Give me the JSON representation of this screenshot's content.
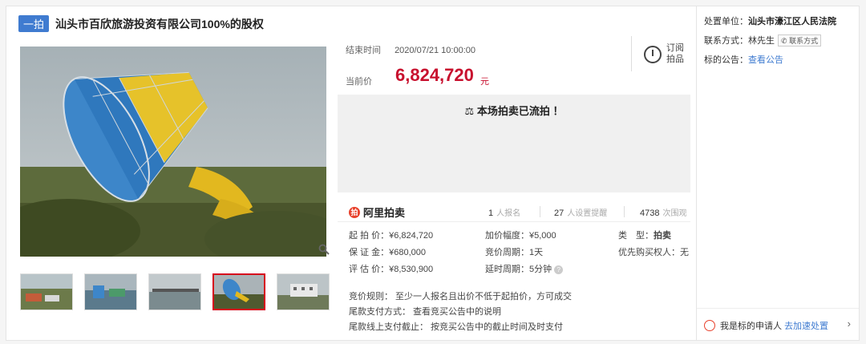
{
  "header": {
    "badge": "一拍",
    "title": "汕头市百欣旅游投资有限公司100%的股权"
  },
  "auction": {
    "end_label": "结束时间",
    "end_time": "2020/07/21 10:00:00",
    "price_label": "当前价",
    "price": "6,824,720",
    "price_unit": "元",
    "subscribe": "订阅拍品",
    "status": "本场拍卖已流拍 ！"
  },
  "platform": {
    "name": "阿里拍卖",
    "signups": "1",
    "signups_unit": "人报名",
    "reminders": "27",
    "reminders_unit": "人设置提醒",
    "watchers": "4738",
    "watchers_unit": "次围观"
  },
  "details": {
    "start_price": "起 拍 价：¥6,824,720",
    "increment": "加价幅度：¥5,000",
    "type_label": "类　型：",
    "type_value": "拍卖",
    "deposit": "保 证 金：¥680,000",
    "period": "竞价周期：1天",
    "priority": "优先购买权人：无",
    "appraisal": "评 估 价：¥8,530,900",
    "delay": "延时周期：5分钟"
  },
  "rules": {
    "rule": "竞价规则： 至少一人报名且出价不低于起拍价，方可成交",
    "payment": "尾款支付方式： 查看竞买公告中的说明",
    "deadline": "尾款线上支付截止： 按竞买公告中的截止时间及时支付"
  },
  "side": {
    "court_label": "处置单位：",
    "court": "汕头市濠江区人民法院",
    "contact_label": "联系方式：林先生",
    "contact_btn": "联系方式",
    "notice_label": "标的公告：",
    "notice_link": "查看公告",
    "applicant_text": "我是标的申请人",
    "applicant_link": "去加速处置"
  },
  "colors": {
    "price": "#c8102e",
    "accent": "#3f7bd0",
    "alibaba": "#e8412c"
  },
  "icons": [
    "zoom-icon",
    "alarm-clock-icon",
    "gavel-icon",
    "alibaba-logo-icon",
    "help-icon",
    "hand-icon",
    "chevron-right-icon"
  ]
}
